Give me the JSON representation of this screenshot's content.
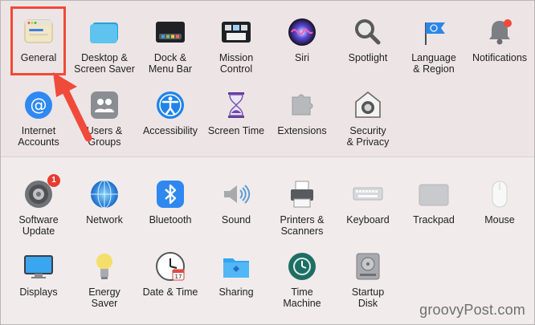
{
  "panes_top": [
    {
      "label": "General",
      "icon": "general-icon",
      "highlighted": true
    },
    {
      "label": "Desktop &\nScreen Saver",
      "icon": "desktop-screensaver-icon"
    },
    {
      "label": "Dock &\nMenu Bar",
      "icon": "dock-menubar-icon"
    },
    {
      "label": "Mission\nControl",
      "icon": "mission-control-icon"
    },
    {
      "label": "Siri",
      "icon": "siri-icon"
    },
    {
      "label": "Spotlight",
      "icon": "spotlight-icon"
    },
    {
      "label": "Language\n& Region",
      "icon": "language-region-icon"
    },
    {
      "label": "Notifications",
      "icon": "notifications-icon"
    },
    {
      "label": "Internet\nAccounts",
      "icon": "internet-accounts-icon"
    },
    {
      "label": "Users &\nGroups",
      "icon": "users-groups-icon"
    },
    {
      "label": "Accessibility",
      "icon": "accessibility-icon"
    },
    {
      "label": "Screen Time",
      "icon": "screen-time-icon"
    },
    {
      "label": "Extensions",
      "icon": "extensions-icon"
    },
    {
      "label": "Security\n& Privacy",
      "icon": "security-privacy-icon"
    }
  ],
  "panes_bottom": [
    {
      "label": "Software\nUpdate",
      "icon": "software-update-icon",
      "badge": "1"
    },
    {
      "label": "Network",
      "icon": "network-icon"
    },
    {
      "label": "Bluetooth",
      "icon": "bluetooth-icon"
    },
    {
      "label": "Sound",
      "icon": "sound-icon"
    },
    {
      "label": "Printers &\nScanners",
      "icon": "printers-scanners-icon"
    },
    {
      "label": "Keyboard",
      "icon": "keyboard-icon"
    },
    {
      "label": "Trackpad",
      "icon": "trackpad-icon"
    },
    {
      "label": "Mouse",
      "icon": "mouse-icon"
    },
    {
      "label": "Displays",
      "icon": "displays-icon"
    },
    {
      "label": "Energy\nSaver",
      "icon": "energy-saver-icon"
    },
    {
      "label": "Date & Time",
      "icon": "date-time-icon"
    },
    {
      "label": "Sharing",
      "icon": "sharing-icon"
    },
    {
      "label": "Time\nMachine",
      "icon": "time-machine-icon"
    },
    {
      "label": "Startup\nDisk",
      "icon": "startup-disk-icon"
    }
  ],
  "date_icon_day": "17",
  "watermark": "groovyPost.com",
  "colors": {
    "highlight": "#f04a3b",
    "badge": "#e73b31"
  }
}
